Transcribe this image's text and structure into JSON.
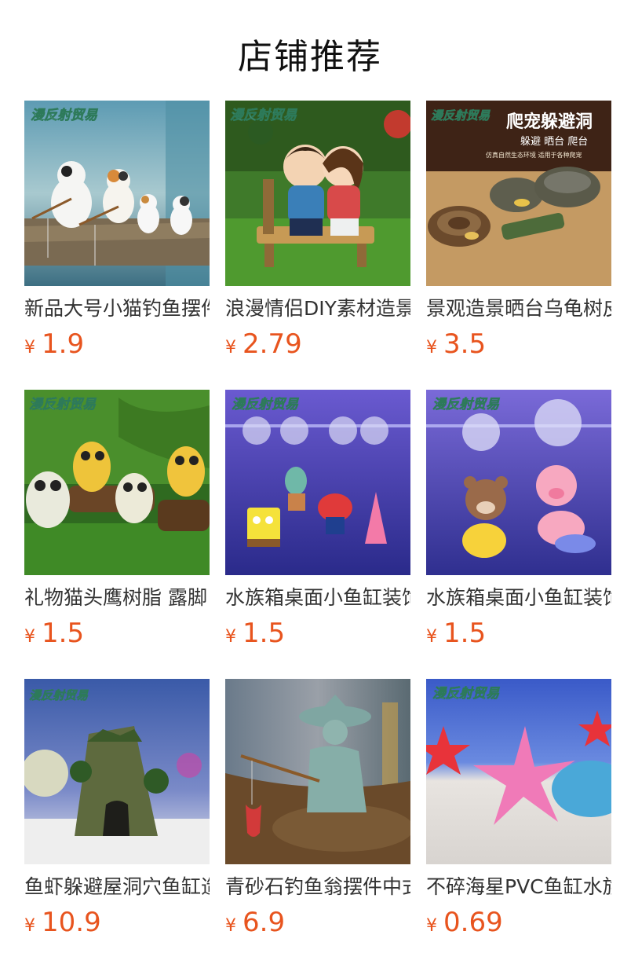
{
  "section_title": "店铺推荐",
  "currency_symbol": "¥",
  "watermark": "漫反射贸易",
  "products": [
    {
      "name": "新品大号小猫钓鱼摆件",
      "price": "1.9"
    },
    {
      "name": "浪漫情侣DIY素材造景",
      "price": "2.79",
      "icon": "couple-bench-image"
    },
    {
      "name": "景观造景晒台乌龟树皮",
      "price": "3.5",
      "banner_title": "爬宠躲避洞",
      "banner_sub": "躲避 晒台 爬台",
      "banner_note": "仿真自然生态环境 适用于各种爬宠"
    },
    {
      "name": "礼物猫头鹰树脂 露脚",
      "price": "1.5"
    },
    {
      "name": "水族箱桌面小鱼缸装饰",
      "price": "1.5"
    },
    {
      "name": "水族箱桌面小鱼缸装饰",
      "price": "1.5"
    },
    {
      "name": "鱼虾躲避屋洞穴鱼缸造景",
      "price": "10.9"
    },
    {
      "name": "青砂石钓鱼翁摆件中式",
      "price": "6.9"
    },
    {
      "name": "不碎海星PVC鱼缸水族",
      "price": "0.69"
    }
  ]
}
